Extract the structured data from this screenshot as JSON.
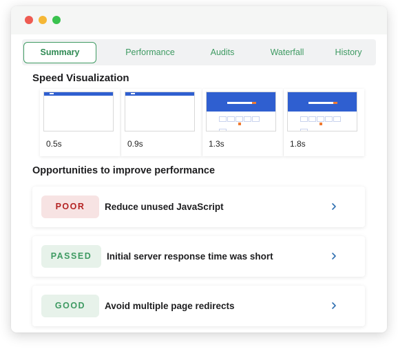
{
  "window": {
    "controls": [
      "close",
      "minimize",
      "maximize"
    ]
  },
  "tabs": [
    {
      "label": "Summary",
      "active": true
    },
    {
      "label": "Performance",
      "active": false
    },
    {
      "label": "Audits",
      "active": false
    },
    {
      "label": "Waterfall",
      "active": false
    },
    {
      "label": "History",
      "active": false
    }
  ],
  "speed": {
    "title": "Speed Visualization",
    "frames": [
      {
        "time": "0.5s",
        "state": "header-only"
      },
      {
        "time": "0.9s",
        "state": "header-only"
      },
      {
        "time": "1.3s",
        "state": "full"
      },
      {
        "time": "1.8s",
        "state": "full"
      }
    ]
  },
  "opportunities": {
    "title": "Opportunities to improve performance",
    "items": [
      {
        "status": "POOR",
        "title": "Reduce unused JavaScript",
        "badge_bg": "#f7e3e3",
        "badge_color": "#b42323",
        "chevron_icon": "chevron-right-icon"
      },
      {
        "status": "PASSED",
        "title": "Initial server response time was short",
        "badge_bg": "#e7f2ea",
        "badge_color": "#3e9a62",
        "chevron_icon": "chevron-right-icon"
      },
      {
        "status": "GOOD",
        "title": "Avoid multiple page redirects",
        "badge_bg": "#e7f2ea",
        "badge_color": "#3e9a62",
        "chevron_icon": "chevron-right-icon"
      }
    ]
  },
  "colors": {
    "accent": "#3e9a62",
    "chevron": "#2f6fb0",
    "page_header_blue": "#2f5fd0"
  }
}
